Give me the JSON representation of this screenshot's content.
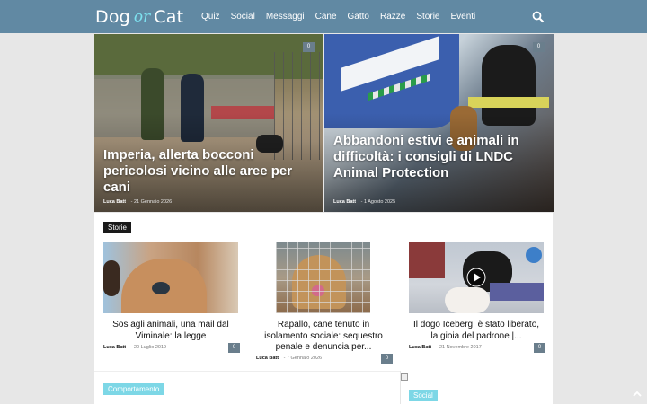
{
  "header": {
    "logo": {
      "part1": "Dog",
      "part2": "or",
      "part3": "Cat"
    },
    "nav": [
      "Quiz",
      "Social",
      "Messaggi",
      "Cane",
      "Gatto",
      "Razze",
      "Storie",
      "Eventi"
    ],
    "search_icon": "search-icon"
  },
  "hero": [
    {
      "title": "Imperia, allerta bocconi pericolosi vicino alle aree per cani",
      "author": "Luca Batt",
      "date": "21 Gennaio 2026",
      "comments": "0"
    },
    {
      "title": "Abbandoni estivi e animali in difficoltà: i consigli di LNDC Animal Protection",
      "author": "Luca Batt",
      "date": "1 Agosto 2025",
      "comments": "0"
    }
  ],
  "storie": {
    "label": "Storie",
    "cards": [
      {
        "title": "Sos agli animali, una mail dal Viminale: la legge",
        "author": "Luca Batt",
        "date": "20 Luglio 2019",
        "comments": "0"
      },
      {
        "title": "Rapallo, cane tenuto in isolamento sociale: sequestro penale e denuncia per...",
        "author": "Luca Batt",
        "date": "7 Gennaio 2026",
        "comments": "0"
      },
      {
        "title": "Il dogo Iceberg, è stato liberato, la gioia del padrone |...",
        "author": "Luca Batt",
        "date": "21 Novembre 2017",
        "comments": "0"
      }
    ]
  },
  "comportamento_label": "Comportamento",
  "social_label": "Social",
  "colors": {
    "header": "#6189a3",
    "accent": "#7dd7e6",
    "badge": "#6a7e8c"
  }
}
